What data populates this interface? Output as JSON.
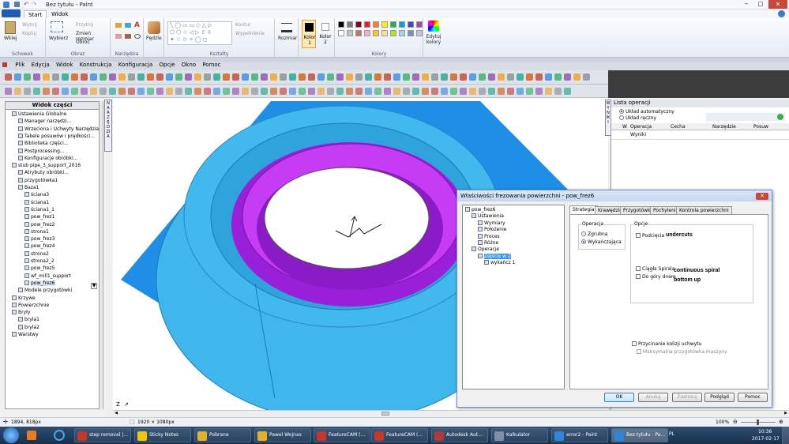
{
  "paint": {
    "window_title": "Bez tytułu - Paint",
    "tabs": [
      "Start",
      "Widok"
    ],
    "groups": {
      "schowek": {
        "label": "Schowek",
        "wklej": "Wklej",
        "wytnij": "Wytnij",
        "kopiuj": "Kopiuj"
      },
      "obraz": {
        "label": "Obraz",
        "wybierz": "Wybierz",
        "przytnij": "Przytnij",
        "zmien": "Zmień rozmiar",
        "obroc": "Obróć"
      },
      "narzedzia": {
        "label": "Narzędzia"
      },
      "pedzle": "Pędzle",
      "ksztalty": {
        "label": "Kształty",
        "kontur": "Kontur",
        "wypelnienie": "Wypełnienie"
      },
      "rozmiar": "Rozmiar",
      "kolor1": "Kolor 1",
      "kolor2": "Kolor 2",
      "kolory": {
        "label": "Kolory",
        "edytuj": "Edytuj kolory"
      }
    },
    "palette": [
      "#000000",
      "#7f7f7f",
      "#880015",
      "#ed1c24",
      "#ff7f27",
      "#fff200",
      "#22b14c",
      "#00a2e8",
      "#3f48cc",
      "#a349a4",
      "#ffffff",
      "#c3c3c3",
      "#b97a57",
      "#ffaec9",
      "#ffc90e",
      "#efe4b0",
      "#b5e61d",
      "#99d9ea",
      "#7092be",
      "#c8bfe7"
    ]
  },
  "featurecam": {
    "menu": [
      "Plik",
      "Edycja",
      "Widok",
      "Konstrukcja",
      "Konfiguracja",
      "Opcje",
      "Okno",
      "Pomoc"
    ],
    "left_panel": {
      "title": "Widok części",
      "items": [
        "Ustawienia Globalne",
        "Manager narzędzi...",
        "Wrzeciona i Uchwyty Narzędzia",
        "Tabele posuwów i prędkości...",
        "Biblioteka części...",
        "Postprocessing...",
        "Konfiguracje obróbki...",
        "stub pipe_3_support_2016",
        "Atrybuty obróbki...",
        "przygotówka1",
        "Baza1",
        "ściana3",
        "ściana1",
        "ściana1_1",
        "pow_frez1",
        "pow_frez2",
        "strona1",
        "pow_frez3",
        "pow_frez4",
        "strona2",
        "strona2_2",
        "pow_frez5",
        "wf_mill1_support",
        "pow_frez6",
        "Modele przygotówki",
        "Krzywe",
        "Powierzchnie",
        "Bryły",
        "bryla1",
        "bryla2",
        "Warstwy"
      ]
    },
    "vertical_strip": "NARZĘDZIA",
    "right_vertical_strip": "WYNIKI",
    "right_panel": {
      "title": "Lista operacji",
      "radio_auto": "Układ automatyczny",
      "radio_manual": "Układ ręczny",
      "columns": [
        "W",
        "Operacja",
        "Cecha",
        "Narzędzie",
        "Posuw"
      ],
      "row": "Wyniki"
    },
    "axis_label": "Z"
  },
  "dialog": {
    "title": "Właściwości frezowania powierzchni - pow_frez6",
    "tree": [
      "pow_frez6",
      "Ustawienia",
      "Wymiary",
      "Położenie",
      "Proces",
      "Różne",
      "Operacje",
      "Zejście w Z",
      "wykańcz 1"
    ],
    "tabs": [
      "Strategia",
      "Krawędzie",
      "Przygotówka",
      "Pochylenia",
      "Kontrola powierzchni"
    ],
    "operacja_label": "Operacja",
    "zgrubna": "Zgrubna",
    "wykanczajaca": "Wykańczająca",
    "opcje_label": "Opcje",
    "podciecia": "Podcięcia",
    "undercuts": "undercuts",
    "ciagla": "Ciągła Spirala",
    "continuous": "continuous spiral",
    "do_gory": "Do góry dnem",
    "bottom_up": "bottom up",
    "przycinanie": "Przycinanie kolizji uchwytu",
    "maksymalna": "Maksymalna przygotówka maszyny",
    "buttons": {
      "ok": "OK",
      "anuluj": "Anuluj",
      "zastosuj": "Zastosuj",
      "podglad": "Podgląd",
      "pomoc": "Pomoc"
    }
  },
  "statusbar": {
    "coords": "1894, 818px",
    "dims": "1920 × 1080px",
    "zoom": "100%"
  },
  "taskbar": {
    "items": [
      "step removal |...",
      "Sticky Notes",
      "Pobrane",
      "Pawel Wojnas",
      "FeatureCAM (...",
      "FeatureCAM (...",
      "Autodesk Aut...",
      "Kalkulator",
      "error2 - Paint",
      "Bez tytułu - Pa..."
    ],
    "lang": "PL",
    "time": "10:36",
    "date": "2017-02-17"
  }
}
